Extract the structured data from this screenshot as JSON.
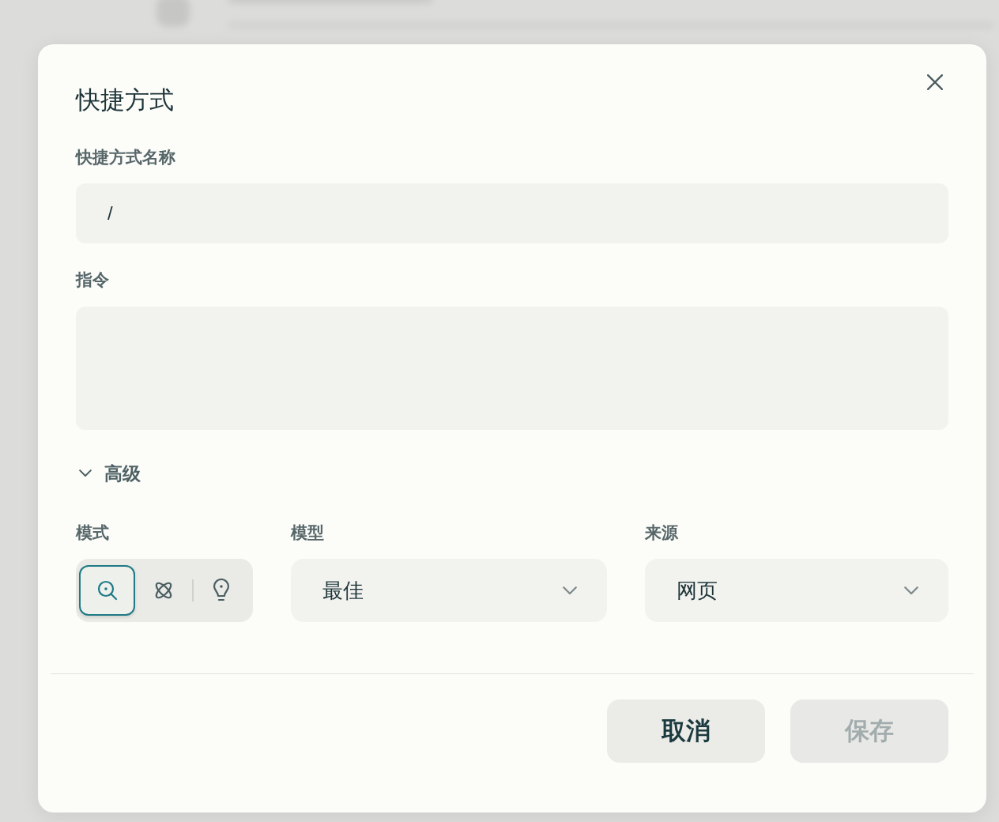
{
  "dialog": {
    "title": "快捷方式"
  },
  "fields": [
    {
      "kind": "input",
      "label": "快捷方式名称",
      "value": "/"
    },
    {
      "kind": "textarea",
      "label": "指令"
    }
  ],
  "advanced": {
    "label": "高级",
    "expanded": true,
    "mode": {
      "label": "模式",
      "options": [
        {
          "kind": "search",
          "selected": true
        },
        {
          "kind": "loops",
          "selected": false
        },
        {
          "kind": "bulb",
          "selected": false
        }
      ]
    },
    "model": {
      "label": "模型",
      "value": "最佳"
    },
    "source": {
      "label": "来源",
      "value": "网页"
    }
  },
  "buttons": [
    {
      "label": "取消",
      "disabled": false
    },
    {
      "label": "保存",
      "disabled": true
    }
  ]
}
